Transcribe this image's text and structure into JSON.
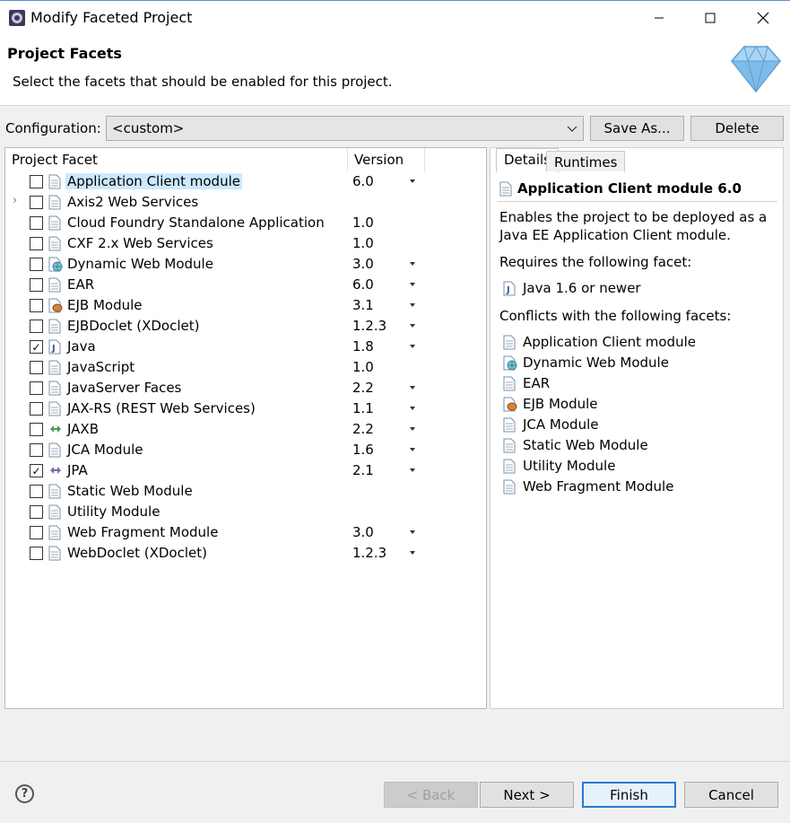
{
  "window": {
    "title": "Modify Faceted Project"
  },
  "banner": {
    "heading": "Project Facets",
    "description": "Select the facets that should be enabled for this project."
  },
  "configuration": {
    "label": "Configuration:",
    "value": "<custom>",
    "save_as": "Save As...",
    "delete": "Delete"
  },
  "facet_table": {
    "col_facet": "Project Facet",
    "col_version": "Version",
    "rows": [
      {
        "label": "Application Client module",
        "version": "6.0",
        "checked": false,
        "icon": "file-icon",
        "dropdown": true,
        "selected": true
      },
      {
        "label": "Axis2 Web Services",
        "version": "",
        "checked": false,
        "icon": "file-icon",
        "dropdown": false,
        "expandable": true
      },
      {
        "label": "Cloud Foundry Standalone Application",
        "version": "1.0",
        "checked": false,
        "icon": "file-icon",
        "dropdown": false
      },
      {
        "label": "CXF 2.x Web Services",
        "version": "1.0",
        "checked": false,
        "icon": "file-icon",
        "dropdown": false
      },
      {
        "label": "Dynamic Web Module",
        "version": "3.0",
        "checked": false,
        "icon": "web-globe-icon",
        "dropdown": true
      },
      {
        "label": "EAR",
        "version": "6.0",
        "checked": false,
        "icon": "file-icon",
        "dropdown": true
      },
      {
        "label": "EJB Module",
        "version": "3.1",
        "checked": false,
        "icon": "ejb-bean-icon",
        "dropdown": true
      },
      {
        "label": "EJBDoclet (XDoclet)",
        "version": "1.2.3",
        "checked": false,
        "icon": "file-icon",
        "dropdown": true
      },
      {
        "label": "Java",
        "version": "1.8",
        "checked": true,
        "icon": "java-file-icon",
        "dropdown": true
      },
      {
        "label": "JavaScript",
        "version": "1.0",
        "checked": false,
        "icon": "file-icon",
        "dropdown": false
      },
      {
        "label": "JavaServer Faces",
        "version": "2.2",
        "checked": false,
        "icon": "file-icon",
        "dropdown": true
      },
      {
        "label": "JAX-RS (REST Web Services)",
        "version": "1.1",
        "checked": false,
        "icon": "file-icon",
        "dropdown": true
      },
      {
        "label": "JAXB",
        "version": "2.2",
        "checked": false,
        "icon": "jaxb-arrows-icon",
        "dropdown": true
      },
      {
        "label": "JCA Module",
        "version": "1.6",
        "checked": false,
        "icon": "file-icon",
        "dropdown": true
      },
      {
        "label": "JPA",
        "version": "2.1",
        "checked": true,
        "icon": "jpa-arrows-icon",
        "dropdown": true
      },
      {
        "label": "Static Web Module",
        "version": "",
        "checked": false,
        "icon": "file-icon",
        "dropdown": false
      },
      {
        "label": "Utility Module",
        "version": "",
        "checked": false,
        "icon": "file-icon",
        "dropdown": false
      },
      {
        "label": "Web Fragment Module",
        "version": "3.0",
        "checked": false,
        "icon": "file-icon",
        "dropdown": true
      },
      {
        "label": "WebDoclet (XDoclet)",
        "version": "1.2.3",
        "checked": false,
        "icon": "file-icon",
        "dropdown": true
      }
    ]
  },
  "details": {
    "tab_details": "Details",
    "tab_runtimes": "Runtimes",
    "title": "Application Client module 6.0",
    "description": "Enables the project to be deployed as a Java EE Application Client module.",
    "requires_label": "Requires the following facet:",
    "requires": [
      {
        "label": "Java 1.6 or newer",
        "icon": "java-file-icon"
      }
    ],
    "conflicts_label": "Conflicts with the following facets:",
    "conflicts": [
      {
        "label": "Application Client module",
        "icon": "file-icon"
      },
      {
        "label": "Dynamic Web Module",
        "icon": "web-globe-icon"
      },
      {
        "label": "EAR",
        "icon": "file-icon"
      },
      {
        "label": "EJB Module",
        "icon": "ejb-bean-icon"
      },
      {
        "label": "JCA Module",
        "icon": "file-icon"
      },
      {
        "label": "Static Web Module",
        "icon": "file-icon"
      },
      {
        "label": "Utility Module",
        "icon": "file-icon"
      },
      {
        "label": "Web Fragment Module",
        "icon": "file-icon"
      }
    ]
  },
  "footer": {
    "help": "?",
    "back": "< Back",
    "next": "Next >",
    "finish": "Finish",
    "cancel": "Cancel"
  }
}
